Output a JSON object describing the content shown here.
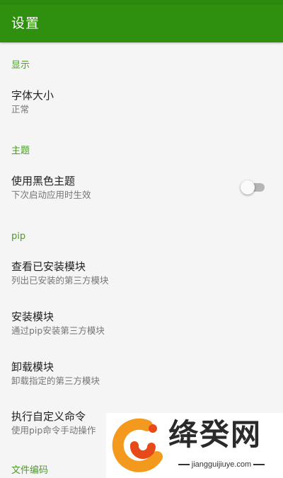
{
  "toolbar": {
    "title": "设置"
  },
  "sections": {
    "display": {
      "header": "显示",
      "font_size": {
        "title": "字体大小",
        "summary": "正常"
      }
    },
    "theme": {
      "header": "主题",
      "dark_theme": {
        "title": "使用黑色主题",
        "summary": "下次启动应用时生效",
        "enabled": false
      }
    },
    "pip": {
      "header": "pip",
      "installed": {
        "title": "查看已安装模块",
        "summary": "列出已安装的第三方模块"
      },
      "install": {
        "title": "安装模块",
        "summary": "通过pip安装第三方模块"
      },
      "uninstall": {
        "title": "卸载模块",
        "summary": "卸载指定的第三方模块"
      },
      "custom": {
        "title": "执行自定义命令",
        "summary": "使用pip命令手动操作"
      }
    },
    "encoding": {
      "header": "文件编码"
    }
  },
  "watermark": {
    "text": "绛癸网",
    "url": "jiangguijiuye.com"
  },
  "colors": {
    "toolbar": "#2f8f0e",
    "section_header": "#4d9a2a",
    "logo_orange": "#f39a1e",
    "logo_red": "#e64a19"
  }
}
